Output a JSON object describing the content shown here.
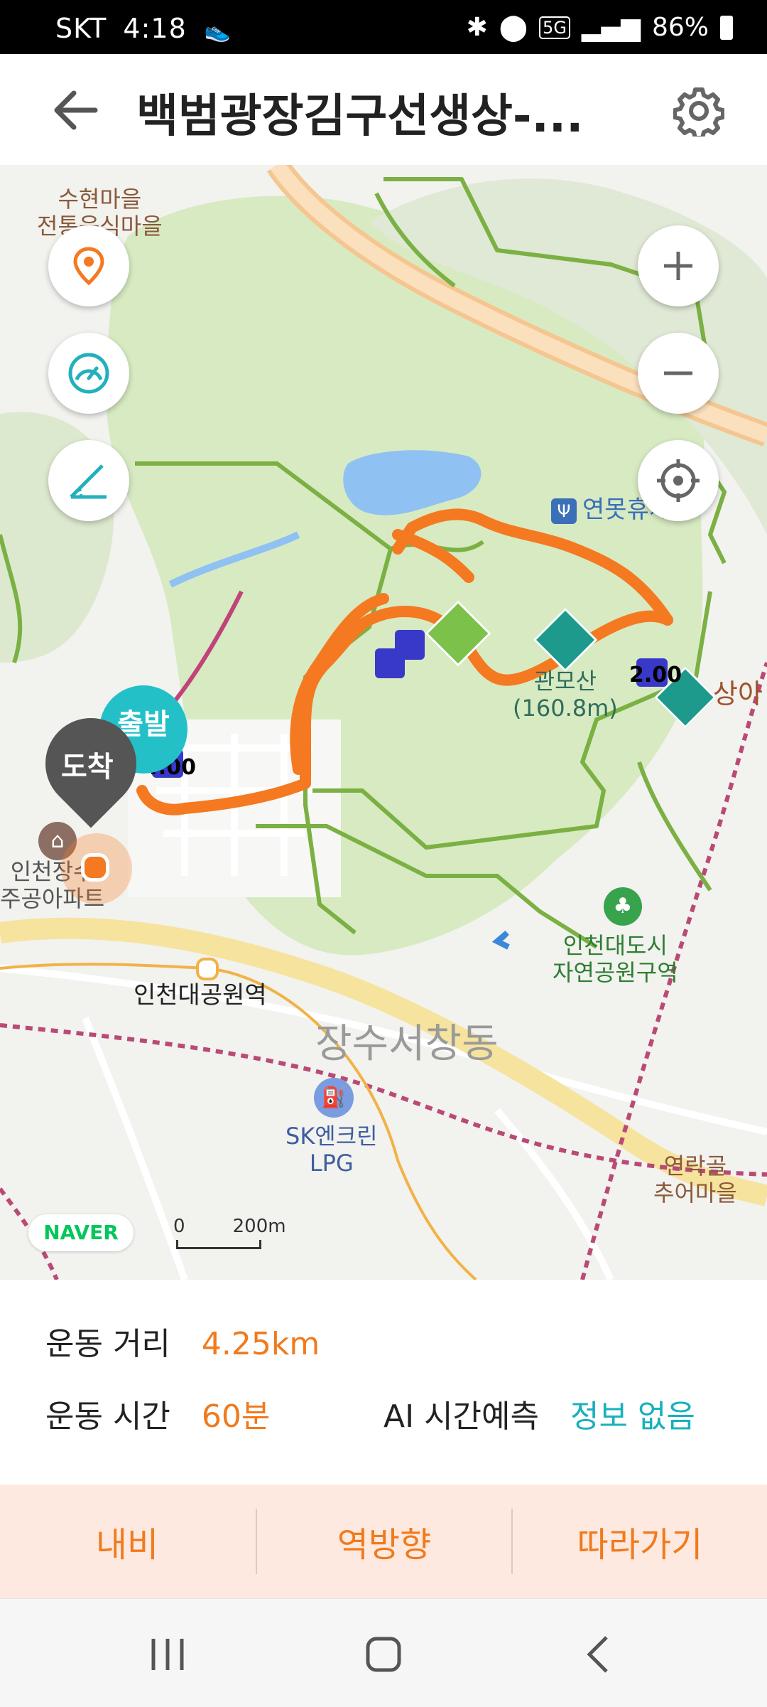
{
  "status_bar": {
    "carrier": "SKT",
    "time": "4:18",
    "battery": "86%",
    "icons": [
      "shoe-icon",
      "bluetooth-icon",
      "location-icon",
      "5g-icon",
      "signal-icon",
      "battery-icon"
    ]
  },
  "header": {
    "title": "백범광장김구선생상-...",
    "back_icon": "back-arrow-icon",
    "settings_icon": "gear-icon"
  },
  "map": {
    "labels": {
      "suhyeon": "수현마을\n전통음식마을",
      "yeonmot": "연못휴게소",
      "gwanmosan": "관모산\n(160.8m)",
      "sanga": "상아",
      "apartment": "인천장수\n주공아파트",
      "station": "인천대공원역",
      "natpark": "인천대도시\n자연공원구역",
      "dong": "장수서창동",
      "lpg": "SK엔크린\nLPG",
      "yeonrakgol": "연락골\n추어마을",
      "naver": "NAVER",
      "scale": "200m",
      "scale_zero": "0"
    },
    "markers": {
      "start": "출발",
      "end": "도착",
      "km4": "4.00",
      "km2": "2.00"
    },
    "controls": [
      "location-pin-icon",
      "speedometer-icon",
      "angle-measure-icon",
      "zoom-in-icon",
      "zoom-out-icon",
      "crosshair-icon"
    ]
  },
  "stats": {
    "distance_label": "운동 거리",
    "distance_value": "4.25km",
    "time_label": "운동 시간",
    "time_value": "60분",
    "ai_label": "AI 시간예측",
    "ai_value": "정보 없음"
  },
  "actions": {
    "navigate": "내비",
    "reverse": "역방향",
    "follow": "따라가기"
  },
  "colors": {
    "accent": "#f07a1d",
    "teal": "#19b0bd",
    "park": "#d7eac2",
    "route": "#f47920",
    "trail": "#7bb043"
  }
}
